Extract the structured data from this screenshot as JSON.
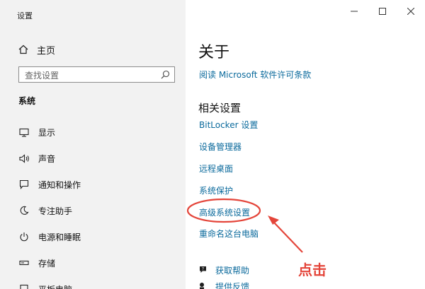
{
  "window": {
    "title": "设置"
  },
  "sidebar": {
    "home_label": "主页",
    "search_placeholder": "查找设置",
    "section_title": "系统",
    "items": [
      {
        "label": "显示",
        "icon": "monitor-icon"
      },
      {
        "label": "声音",
        "icon": "speaker-icon"
      },
      {
        "label": "通知和操作",
        "icon": "notification-icon"
      },
      {
        "label": "专注助手",
        "icon": "moon-icon"
      },
      {
        "label": "电源和睡眠",
        "icon": "power-icon"
      },
      {
        "label": "存储",
        "icon": "storage-icon"
      },
      {
        "label": "平板电脑",
        "icon": "tablet-icon"
      }
    ]
  },
  "main": {
    "heading": "关于",
    "license_link": "阅读 Microsoft 软件许可条款",
    "related_heading": "相关设置",
    "related_links": [
      "BitLocker 设置",
      "设备管理器",
      "远程桌面",
      "系统保护",
      "高级系统设置",
      "重命名这台电脑"
    ],
    "help": [
      {
        "label": "获取帮助",
        "icon": "help-icon"
      },
      {
        "label": "提供反馈",
        "icon": "feedback-icon"
      }
    ]
  },
  "annotation": {
    "text": "点击",
    "color": "#e4453a"
  },
  "colors": {
    "sidebar_bg": "#f2f2f2",
    "link": "#0b6a9c",
    "accent_red": "#e4453a"
  }
}
